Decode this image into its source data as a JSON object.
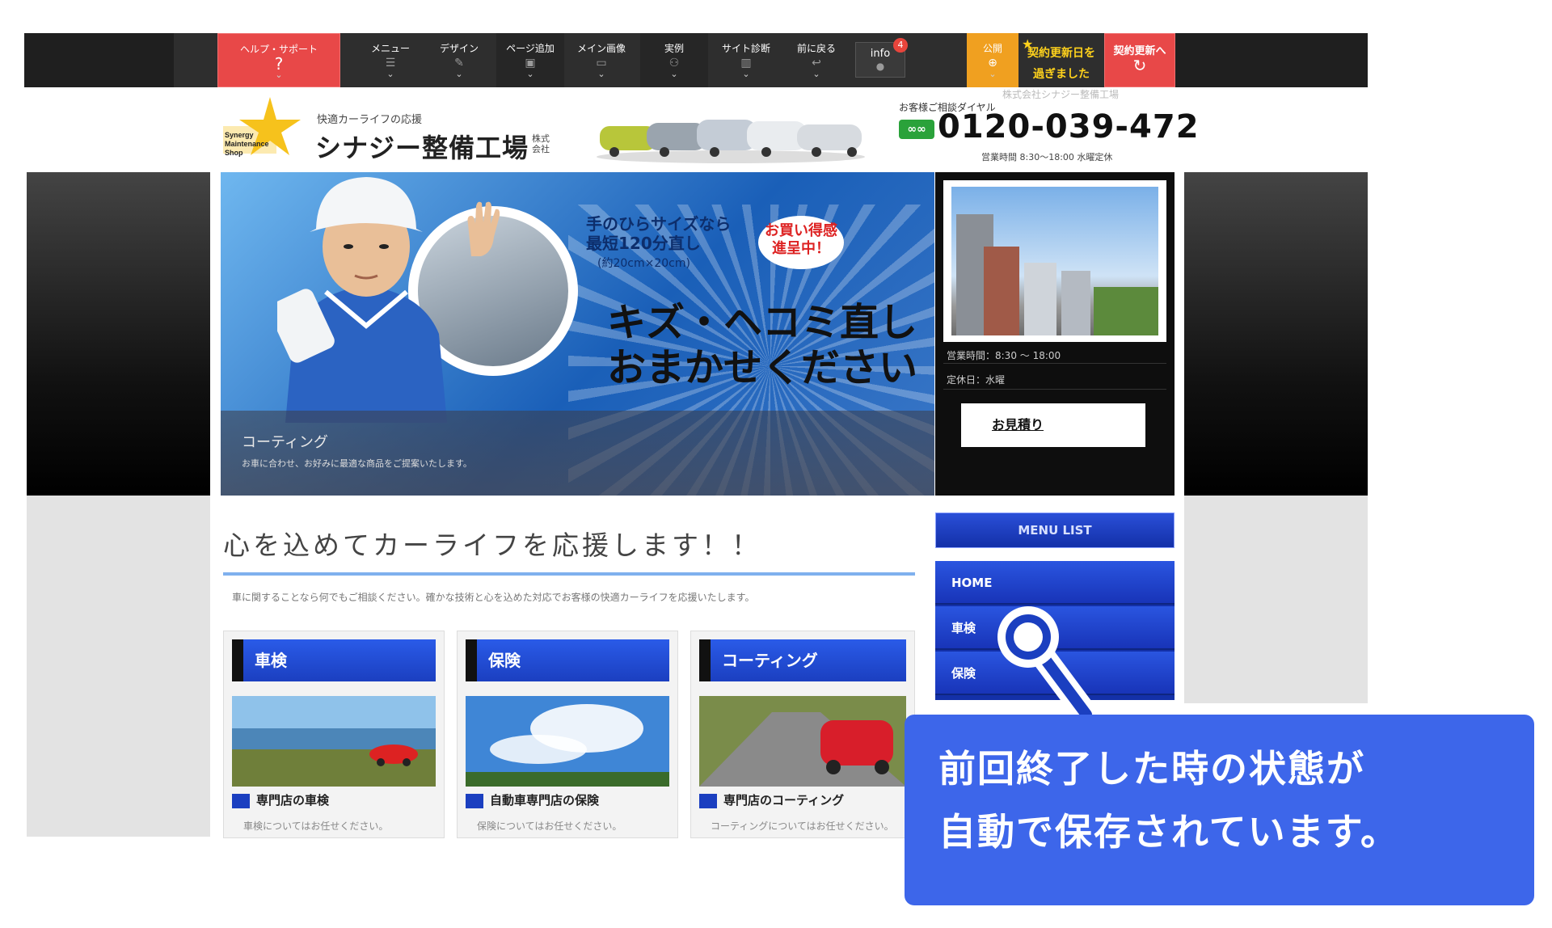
{
  "toolbar": {
    "help": {
      "label": "ヘルプ・サポート",
      "icon": "question-icon"
    },
    "items": [
      {
        "label": "メニュー",
        "icon": "menu-icon"
      },
      {
        "label": "デザイン",
        "icon": "pencil-icon"
      },
      {
        "label": "ページ追加",
        "icon": "page-add-icon"
      },
      {
        "label": "メイン画像",
        "icon": "image-icon"
      },
      {
        "label": "実例",
        "icon": "people-icon"
      },
      {
        "label": "サイト診断",
        "icon": "chart-icon"
      },
      {
        "label": "前に戻る",
        "icon": "undo-icon"
      }
    ],
    "info": {
      "label": "info",
      "badge": "4"
    },
    "publish": {
      "label": "公開",
      "icon": "globe-icon"
    },
    "contract_notice": {
      "line1": "契約更新日を",
      "line2": "過ぎました"
    },
    "renew": {
      "label": "契約更新へ",
      "icon": "refresh-icon"
    }
  },
  "site": {
    "logo_small": "快適カーライフの応援",
    "logo_name": "シナジー整備工場",
    "logo_kaisha": "株式会社",
    "company_line": "株式会社シナジー整備工場",
    "dial_label": "お客様ご相談ダイヤル",
    "freedial": "0120",
    "phone": "0120-039-472",
    "hours": "営業時間 8:30〜18:00 水曜定休",
    "hero": {
      "headline1": "手のひらサイズなら",
      "headline1b": "最短120分直し",
      "headline2": "(約20cm×20cm)",
      "badge": "お買い得感 進呈中！",
      "main1": "キズ・ヘコミ直し",
      "main2": "おまかせください",
      "caption_title": "コーティング",
      "caption_sub": "お車に合わせ、お好みに最適な商品をご提案いたします。"
    },
    "panel": {
      "row1": "営業時間：8:30 〜 18:00",
      "row2": "定休日：水曜",
      "estimate": "お見積り"
    },
    "main_title": "心を込めてカーライフを応援します！！",
    "intro": "車に関することなら何でもご相談ください。確かな技術と心を込めた対応でお客様の快適カーライフを応援いたします。",
    "cards": [
      {
        "head": "車検",
        "sub": "専門店の車検",
        "text": "車検についてはお任せください。"
      },
      {
        "head": "保険",
        "sub": "自動車専門店の保険",
        "text": "保険についてはお任せください。"
      },
      {
        "head": "コーティング",
        "sub": "専門店のコーティング",
        "text": "コーティングについてはお任せください。"
      }
    ],
    "menu_list": {
      "title": "MENU LIST",
      "items": [
        "HOME",
        "車検",
        "保険"
      ]
    }
  },
  "callout": {
    "line1": "前回終了した時の状態が",
    "line2": "自動で保存されています。"
  },
  "colors": {
    "toolbar_bg": "#2e2e2e",
    "help_red": "#e84848",
    "publish_orange": "#f0a020",
    "contract_yellow": "#ffd21c",
    "menu_blue": "#1b3fc0",
    "callout_blue": "#3d66ea"
  }
}
